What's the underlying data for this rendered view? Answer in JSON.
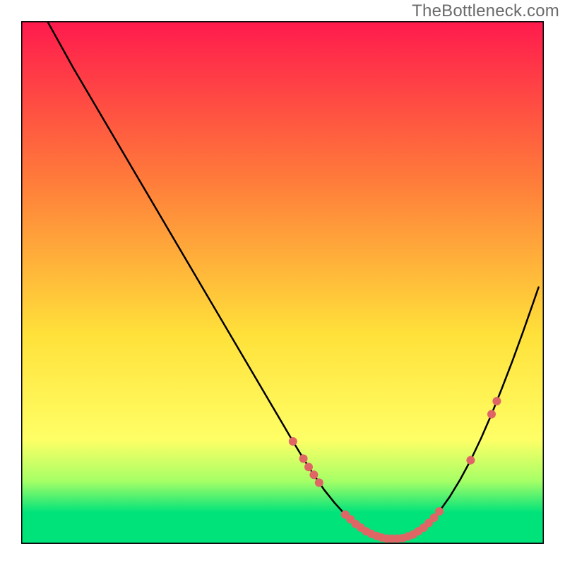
{
  "watermark": "TheBottleneck.com",
  "colors": {
    "gradient_top": "#ff1a4d",
    "gradient_mid1": "#ff7a3a",
    "gradient_mid2": "#ffe13a",
    "gradient_bottom_yellow": "#ffff66",
    "gradient_green_light": "#a6ff66",
    "gradient_green": "#00e37a",
    "axis": "#000000",
    "curve": "#000000",
    "dot": "#e06666",
    "background": "#ffffff"
  },
  "chart_data": {
    "type": "line",
    "title": "",
    "xlabel": "",
    "ylabel": "",
    "xlim": [
      0,
      100
    ],
    "ylim": [
      0,
      100
    ],
    "x": [
      5,
      10,
      15,
      20,
      25,
      30,
      35,
      40,
      45,
      50,
      52,
      54,
      56,
      58,
      60,
      62,
      64,
      66,
      68,
      70,
      72,
      74,
      76,
      78,
      80,
      82,
      84,
      86,
      88,
      90,
      92,
      94,
      96,
      98,
      99
    ],
    "y": [
      100,
      91,
      82.5,
      74,
      65.5,
      57,
      48.5,
      40,
      31.5,
      23,
      19.6,
      16.3,
      13.2,
      10.3,
      7.8,
      5.6,
      3.8,
      2.4,
      1.5,
      1.0,
      1.0,
      1.4,
      2.4,
      4.0,
      6.2,
      9.0,
      12.3,
      16.0,
      20.2,
      24.8,
      29.8,
      35.0,
      40.5,
      46.2,
      49.1
    ],
    "dots": [
      {
        "x": 52,
        "y": 19.6
      },
      {
        "x": 54,
        "y": 16.3
      },
      {
        "x": 55,
        "y": 14.7
      },
      {
        "x": 56,
        "y": 13.2
      },
      {
        "x": 57,
        "y": 11.7
      },
      {
        "x": 62,
        "y": 5.6
      },
      {
        "x": 63,
        "y": 4.7
      },
      {
        "x": 64,
        "y": 3.8
      },
      {
        "x": 65,
        "y": 3.1
      },
      {
        "x": 66,
        "y": 2.4
      },
      {
        "x": 67,
        "y": 1.9
      },
      {
        "x": 68,
        "y": 1.5
      },
      {
        "x": 69,
        "y": 1.2
      },
      {
        "x": 70,
        "y": 1.0
      },
      {
        "x": 71,
        "y": 1.0
      },
      {
        "x": 72,
        "y": 1.0
      },
      {
        "x": 73,
        "y": 1.1
      },
      {
        "x": 74,
        "y": 1.4
      },
      {
        "x": 75,
        "y": 1.8
      },
      {
        "x": 76,
        "y": 2.4
      },
      {
        "x": 77,
        "y": 3.1
      },
      {
        "x": 78,
        "y": 4.0
      },
      {
        "x": 79,
        "y": 5.0
      },
      {
        "x": 80,
        "y": 6.2
      },
      {
        "x": 86,
        "y": 16.0
      },
      {
        "x": 90,
        "y": 24.8
      },
      {
        "x": 91,
        "y": 27.3
      }
    ],
    "gradient_stops_y": [
      100,
      70,
      40,
      20,
      12,
      6,
      0
    ],
    "gradient_stops_color_keys": [
      "gradient_top",
      "gradient_mid1",
      "gradient_mid2",
      "gradient_bottom_yellow",
      "gradient_green_light",
      "gradient_green",
      "gradient_green"
    ]
  }
}
